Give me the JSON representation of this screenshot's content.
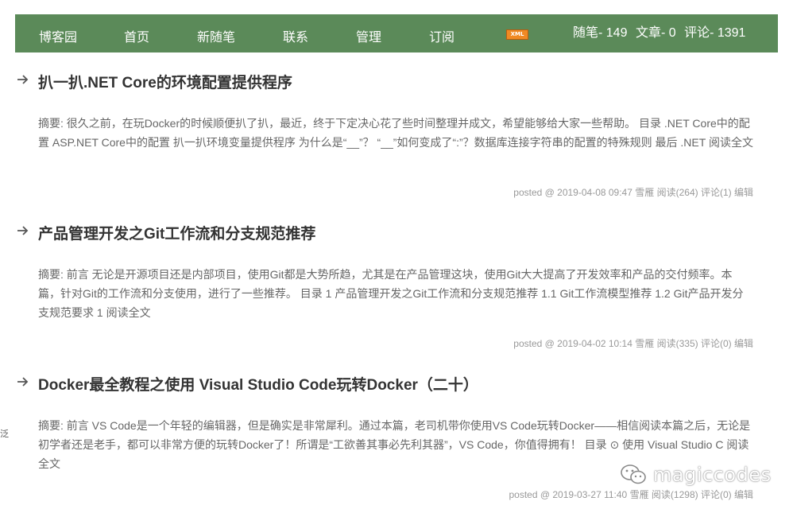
{
  "nav": {
    "items": [
      "博客园",
      "首页",
      "新随笔",
      "联系",
      "管理",
      "订阅"
    ],
    "xml_badge": "XML",
    "stats": {
      "posts": "随笔- 149",
      "articles": "文章- 0",
      "comments": "评论- 1391"
    }
  },
  "posts": [
    {
      "title": "扒一扒.NET Core的环境配置提供程序",
      "summary": "摘要: 很久之前，在玩Docker的时候顺便扒了扒，最近，终于下定决心花了些时间整理并成文，希望能够给大家一些帮助。 目录 .NET Core中的配置 ASP.NET Core中的配置 扒一扒环境变量提供程序 为什么是“__”？ “__”如何变成了“:”？数据库连接字符串的配置的特殊规则 最后 .NET ",
      "read_more": "阅读全文",
      "meta": {
        "posted": "posted @ 2019-04-08 09:47",
        "author": "雪雁",
        "reads": "阅读(264)",
        "comments": "评论(1)",
        "edit": "编辑"
      }
    },
    {
      "title": "产品管理开发之Git工作流和分支规范推荐",
      "summary": "摘要: 前言 无论是开源项目还是内部项目，使用Git都是大势所趋，尤其是在产品管理这块，使用Git大大提高了开发效率和产品的交付频率。本篇，针对Git的工作流和分支使用，进行了一些推荐。 目录 1 产品管理开发之Git工作流和分支规范推荐 1.1 Git工作流模型推荐 1.2 Git产品开发分支规范要求 1 ",
      "read_more": "阅读全文",
      "meta": {
        "posted": "posted @ 2019-04-02 10:14",
        "author": "雪雁",
        "reads": "阅读(335)",
        "comments": "评论(0)",
        "edit": "编辑"
      }
    },
    {
      "title": "Docker最全教程之使用 Visual Studio Code玩转Docker（二十）",
      "summary": "摘要: 前言 VS Code是一个年轻的编辑器，但是确实是非常犀利。通过本篇，老司机带你使用VS Code玩转Docker——相信阅读本篇之后，无论是初学者还是老手，都可以非常方便的玩转Docker了！所谓是“工欲善其事必先利其器”，VS Code，你值得拥有！ 目录 ⊙ 使用 Visual Studio C ",
      "read_more": "阅读全文",
      "meta": {
        "posted": "posted @ 2019-03-27 11:40",
        "author": "雪雁",
        "reads": "阅读(1298)",
        "comments": "评论(0)",
        "edit": "编辑"
      }
    }
  ],
  "edge_char": "泛",
  "watermark": {
    "text": "magiccodes",
    "icon": "wechat-icon"
  },
  "colors": {
    "nav_bg": "#5b8a59",
    "title": "#333333",
    "summary": "#666666",
    "meta": "#999999"
  }
}
